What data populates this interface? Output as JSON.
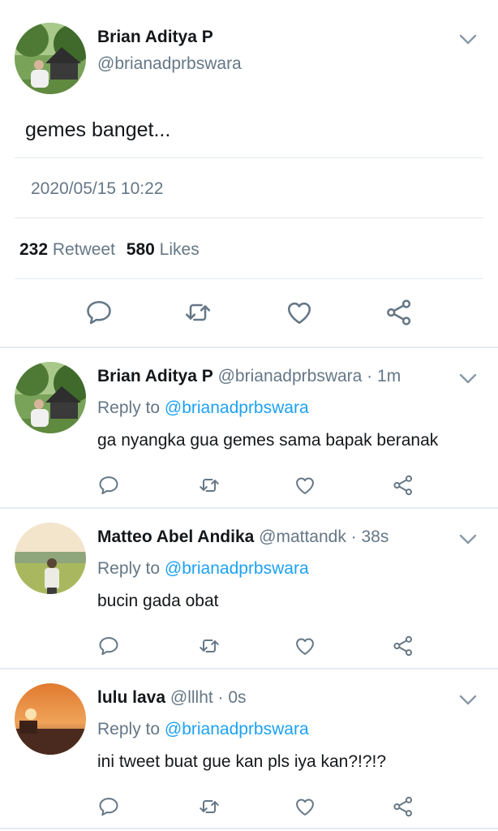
{
  "main_tweet": {
    "author_name": "Brian Aditya P",
    "handle": "@brianadprbswara",
    "text": "gemes banget...",
    "timestamp": "2020/05/15 10:22",
    "retweet_count": "232",
    "retweet_label": "Retweet",
    "likes_count": "580",
    "likes_label": "Likes"
  },
  "replies": [
    {
      "author_name": "Brian Aditya P",
      "meta": "@brianadprbswara · 1m",
      "reply_prefix": "Reply to",
      "reply_handle": "@brianadprbswara",
      "text": "ga nyangka gua gemes sama bapak beranak"
    },
    {
      "author_name": "Matteo Abel Andika",
      "meta": "@mattandk · 38s",
      "reply_prefix": "Reply to",
      "reply_handle": "@brianadprbswara",
      "text": "bucin gada obat"
    },
    {
      "author_name": "lulu lava",
      "meta": "@lllht · 0s",
      "reply_prefix": "Reply to",
      "reply_handle": "@brianadprbswara",
      "text": "ini tweet buat gue kan pls iya kan?!?!?"
    }
  ],
  "icons": [
    "chevron-down-icon",
    "reply-icon",
    "retweet-icon",
    "like-icon",
    "share-icon"
  ],
  "colors": {
    "accent": "#1da1f2",
    "secondary_text": "#657786",
    "icon": "#657786",
    "divider": "#e1e8ed"
  }
}
